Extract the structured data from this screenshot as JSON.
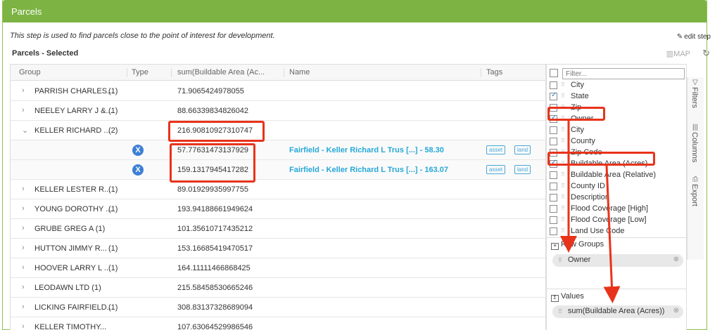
{
  "panel": {
    "title": "Parcels"
  },
  "description": "This step is used to find parcels close to the point of interest for development.",
  "edit_step": "edit step",
  "selected_title": "Parcels - Selected",
  "map_label": "MAP",
  "columns": {
    "group": "Group",
    "type": "Type",
    "sum": "sum(Buildable Area (Ac...",
    "name": "Name",
    "tags": "Tags"
  },
  "rows": [
    {
      "group": "PARRISH CHARLES...",
      "count": "(1)",
      "sum": "71.9065424978055"
    },
    {
      "group": "NEELEY LARRY J &...",
      "count": "(1)",
      "sum": "88.66339834826042"
    },
    {
      "group": "KELLER RICHARD ...",
      "count": "(2)",
      "sum": "216.90810927310747",
      "expanded": true
    },
    {
      "child": true,
      "sum": "57.77631473137929",
      "name": "Fairfield - Keller Richard L Trus [...] - 58.30",
      "tags": [
        "asset",
        "land"
      ]
    },
    {
      "child": true,
      "sum": "159.1317945417282",
      "name": "Fairfield - Keller Richard L Trus [...] - 163.07",
      "tags": [
        "asset",
        "land"
      ]
    },
    {
      "group": "KELLER LESTER R...",
      "count": "(1)",
      "sum": "89.01929935997755"
    },
    {
      "group": "YOUNG DOROTHY ...",
      "count": "(1)",
      "sum": "193.94188661949624"
    },
    {
      "group": "GRUBE GREG A (1)",
      "count": "",
      "sum": "101.35610717435212"
    },
    {
      "group": "HUTTON JIMMY R...",
      "count": "(1)",
      "sum": "153.16685419470517"
    },
    {
      "group": "HOOVER LARRY L ...",
      "count": "(1)",
      "sum": "164.11111466868425"
    },
    {
      "group": "LEODAWN LTD (1)",
      "count": "",
      "sum": "215.58458530665246"
    },
    {
      "group": "LICKING FAIRFIELD...",
      "count": "(1)",
      "sum": "308.83137328689094"
    },
    {
      "group": "KELLER TIMOTHY...",
      "count": "",
      "sum": "107.63064529986546"
    }
  ],
  "tool_panel": {
    "filter_placeholder": "Filter...",
    "items": [
      {
        "label": "City",
        "checked": false
      },
      {
        "label": "State",
        "checked": true
      },
      {
        "label": "Zip",
        "checked": false
      },
      {
        "label": "Owner",
        "checked": true
      },
      {
        "label": "City",
        "checked": false
      },
      {
        "label": "County",
        "checked": false
      },
      {
        "label": "Zip Code",
        "checked": false
      },
      {
        "label": "Buildable Area (Acres)",
        "checked": true
      },
      {
        "label": "Buildable Area (Relative)",
        "checked": false
      },
      {
        "label": "County ID",
        "checked": false
      },
      {
        "label": "Description",
        "checked": false
      },
      {
        "label": "Flood Coverage [High]",
        "checked": false
      },
      {
        "label": "Flood Coverage [Low]",
        "checked": false
      },
      {
        "label": "Land Use Code",
        "checked": false
      }
    ],
    "row_groups_title": "Row Groups",
    "row_group_pill": "Owner",
    "values_title": "Values",
    "values_pill": "sum(Buildable Area (Acres))"
  },
  "side_tabs": {
    "filters": "Filters",
    "columns": "Columns",
    "export": "Export"
  },
  "colors": {
    "header": "#7cb342",
    "link": "#26a8d8",
    "highlight": "#e8331b"
  }
}
